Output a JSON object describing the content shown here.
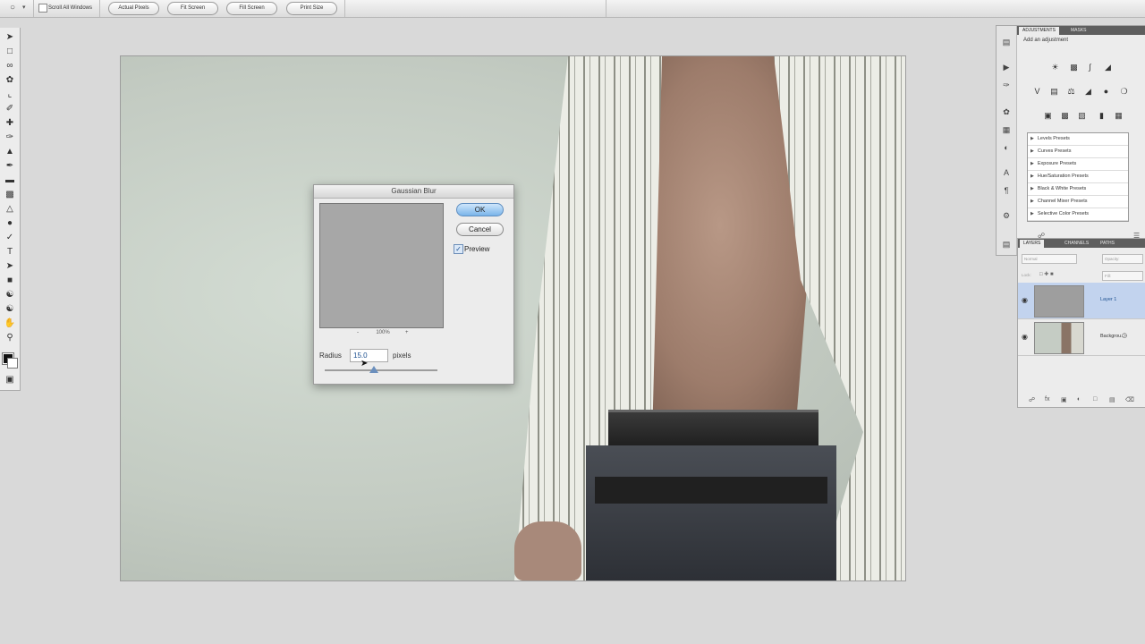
{
  "options_bar": {
    "scroll_all_label": "Scroll All Windows",
    "buttons": [
      "Actual Pixels",
      "Fit Screen",
      "Fill Screen",
      "Print Size"
    ]
  },
  "dialog": {
    "title": "Gaussian Blur",
    "ok": "OK",
    "cancel": "Cancel",
    "preview_label": "Preview",
    "preview_checked": true,
    "zoom": "100%",
    "zoom_minus": "-",
    "zoom_plus": "+",
    "radius_label": "Radius",
    "radius_value": "15.0",
    "units": "pixels",
    "radius_slider_fraction": 0.44
  },
  "adjustments": {
    "tabs": [
      "ADJUSTMENTS",
      "MASKS"
    ],
    "heading": "Add an adjustment",
    "presets": [
      "Levels Presets",
      "Curves Presets",
      "Exposure Presets",
      "Hue/Saturation Presets",
      "Black & White Presets",
      "Channel Mixer Presets",
      "Selective Color Presets"
    ]
  },
  "layers": {
    "tabs": [
      "LAYERS",
      "CHANNELS",
      "PATHS"
    ],
    "blend_mode": "Normal",
    "opacity_label": "Opacity:",
    "lock_label": "Lock:",
    "fill_label": "Fill:",
    "items": [
      {
        "name": "Layer 1",
        "selected": true
      },
      {
        "name": "Backgrou...",
        "selected": false
      }
    ]
  },
  "colors": {
    "ok_button": "#79b4ea",
    "selection": "#c2d3ee",
    "panel_tab_bar": "#5e5e5e",
    "foreground": "#111111",
    "background": "#ffffff"
  }
}
